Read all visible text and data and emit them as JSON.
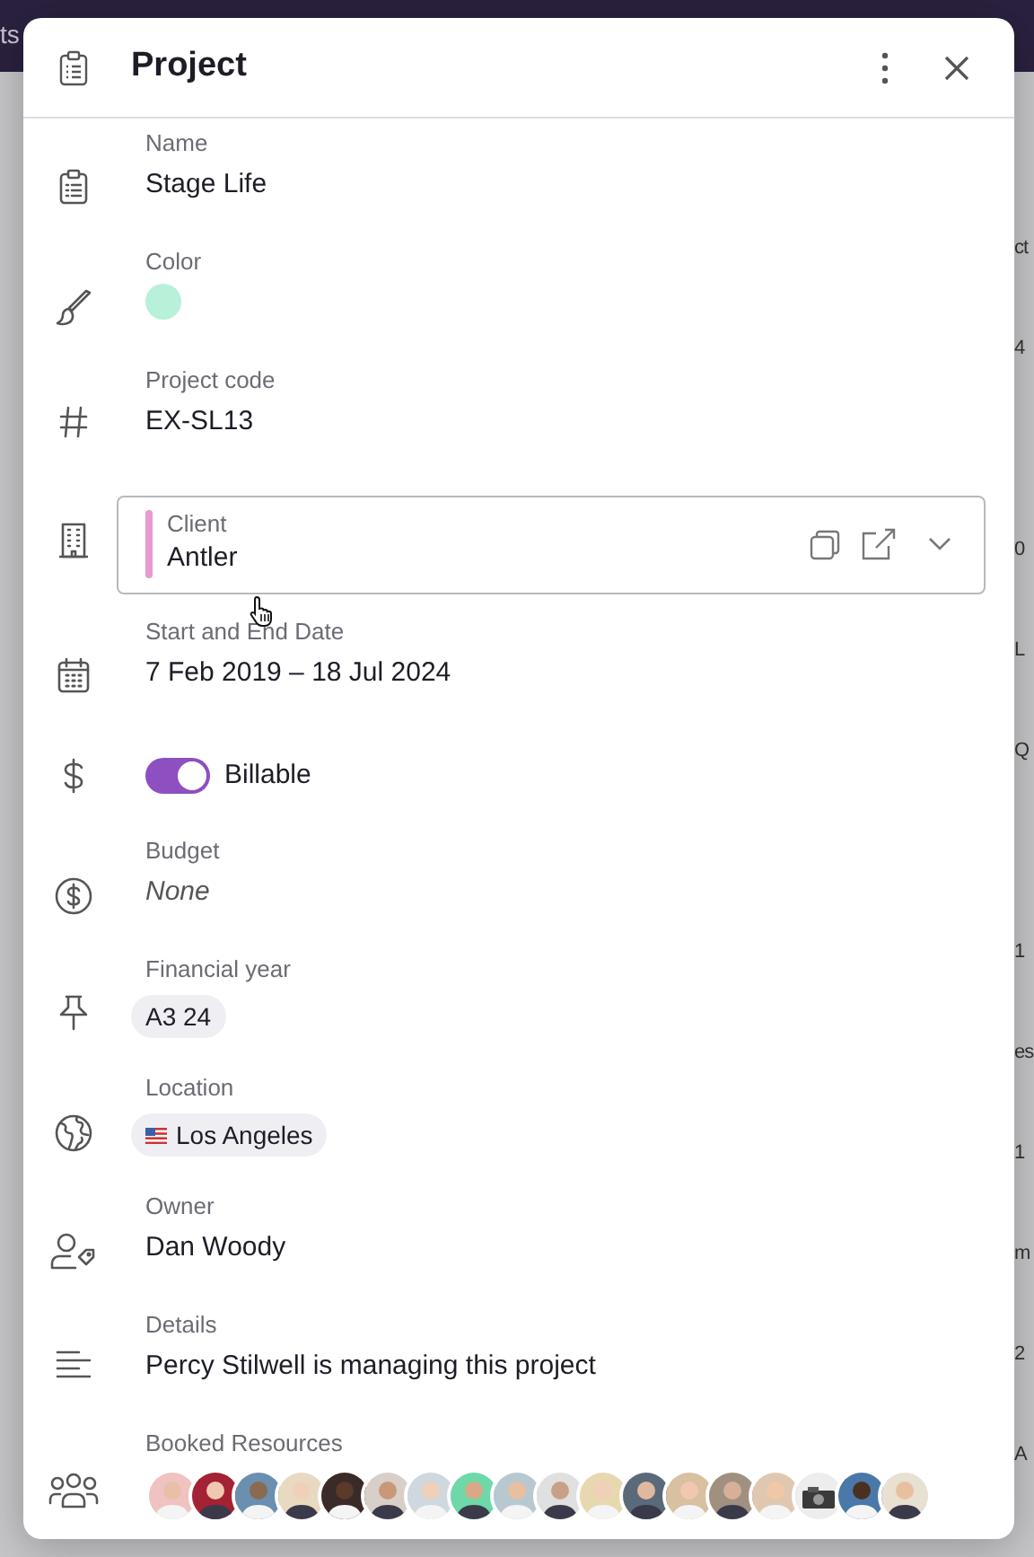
{
  "background_page": {
    "header_fragment": "ts",
    "column_fragments": [
      "ct",
      "4",
      "0",
      "L",
      "Q",
      "1",
      "es",
      "1",
      "m",
      "2",
      "A"
    ]
  },
  "dialog": {
    "title": "Project"
  },
  "fields": [
    {
      "kind": "text",
      "label": "Name",
      "value": "Stage Life"
    },
    {
      "kind": "color",
      "label": "Color",
      "color": "#b8f0da"
    },
    {
      "kind": "text",
      "label": "Project code",
      "value": "EX-SL13"
    },
    {
      "kind": "select",
      "label": "Client",
      "value": "Antler",
      "color": "#e79bd0"
    },
    {
      "kind": "text",
      "label": "Start and End Date",
      "value": "7 Feb 2019 – 18 Jul 2024"
    },
    {
      "kind": "toggle",
      "label": "Billable",
      "on": true
    },
    {
      "kind": "empty",
      "label": "Budget",
      "value": "None"
    },
    {
      "kind": "chip",
      "label": "Financial year",
      "value": "A3 24"
    },
    {
      "kind": "flag-chip",
      "label": "Location",
      "value": "Los Angeles"
    },
    {
      "kind": "text",
      "label": "Owner",
      "value": "Dan Woody"
    },
    {
      "kind": "text",
      "label": "Details",
      "value": "Percy Stilwell is managing this project"
    },
    {
      "kind": "avatars",
      "label": "Booked Resources",
      "avatars": [
        {
          "kind": "person"
        },
        {
          "kind": "person"
        },
        {
          "kind": "person"
        },
        {
          "kind": "person"
        },
        {
          "kind": "person"
        },
        {
          "kind": "person"
        },
        {
          "kind": "person"
        },
        {
          "kind": "person"
        },
        {
          "kind": "person"
        },
        {
          "kind": "person"
        },
        {
          "kind": "person"
        },
        {
          "kind": "person"
        },
        {
          "kind": "person"
        },
        {
          "kind": "person"
        },
        {
          "kind": "person"
        },
        {
          "kind": "object"
        },
        {
          "kind": "person"
        },
        {
          "kind": "person"
        }
      ]
    }
  ]
}
